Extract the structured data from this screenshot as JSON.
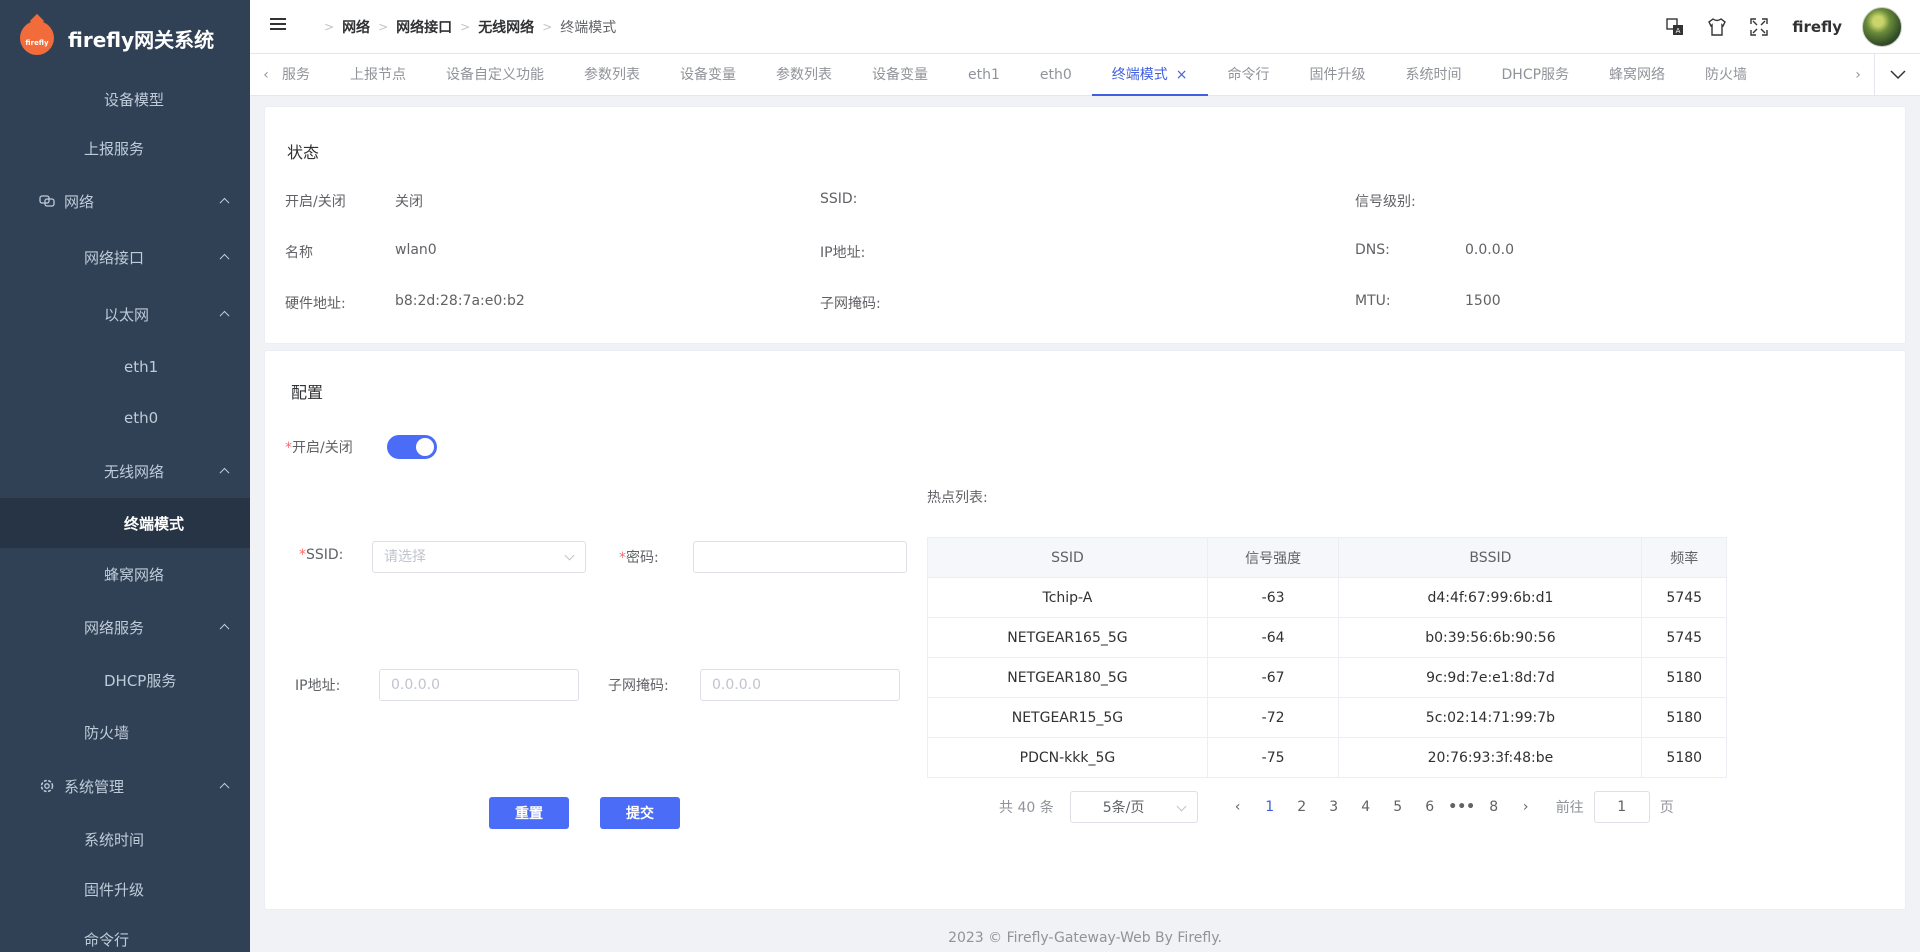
{
  "app": {
    "title": "firefly网关系统",
    "logo_text": "firefly"
  },
  "sidebar": {
    "items": [
      {
        "label": "设备模型"
      },
      {
        "label": "上报服务"
      },
      {
        "label": "网络"
      },
      {
        "label": "网络接口"
      },
      {
        "label": "以太网"
      },
      {
        "label": "eth1"
      },
      {
        "label": "eth0"
      },
      {
        "label": "无线网络"
      },
      {
        "label": "终端模式"
      },
      {
        "label": "蜂窝网络"
      },
      {
        "label": "网络服务"
      },
      {
        "label": "DHCP服务"
      },
      {
        "label": "防火墙"
      },
      {
        "label": "系统管理"
      },
      {
        "label": "系统时间"
      },
      {
        "label": "固件升级"
      },
      {
        "label": "命令行"
      }
    ]
  },
  "header": {
    "breadcrumbs": [
      "网络",
      "网络接口",
      "无线网络",
      "终端模式"
    ],
    "username": "firefly"
  },
  "tabs": {
    "items": [
      "服务",
      "上报节点",
      "设备自定义功能",
      "参数列表",
      "设备变量",
      "参数列表",
      "设备变量",
      "eth1",
      "eth0",
      "终端模式",
      "命令行",
      "固件升级",
      "系统时间",
      "DHCP服务",
      "蜂窝网络",
      "防火墙"
    ],
    "close_icon": "×"
  },
  "status": {
    "title": "状态",
    "enable_label": "开启/关闭",
    "enable_value": "关闭",
    "ssid_label": "SSID:",
    "ssid_value": "",
    "signal_label": "信号级别:",
    "signal_value": "",
    "name_label": "名称",
    "name_value": "wlan0",
    "ip_label": "IP地址:",
    "ip_value": "",
    "dns_label": "DNS:",
    "dns_value": "0.0.0.0",
    "mac_label": "硬件地址:",
    "mac_value": "b8:2d:28:7a:e0:b2",
    "mask_label": "子网掩码:",
    "mask_value": "",
    "mtu_label": "MTU:",
    "mtu_value": "1500"
  },
  "config": {
    "title": "配置",
    "enable_label": "开启/关闭",
    "enable_on": true,
    "ssid_label": "SSID:",
    "ssid_placeholder": "请选择",
    "password_label": "密码:",
    "ip_label": "IP地址:",
    "ip_placeholder": "0.0.0.0",
    "mask_label": "子网掩码:",
    "mask_placeholder": "0.0.0.0",
    "reset_label": "重置",
    "submit_label": "提交",
    "required_mark": "*"
  },
  "hotspots": {
    "title": "热点列表:",
    "columns": [
      "SSID",
      "信号强度",
      "BSSID",
      "频率"
    ],
    "rows": [
      [
        "Tchip-A",
        "-63",
        "d4:4f:67:99:6b:d1",
        "5745"
      ],
      [
        "NETGEAR165_5G",
        "-64",
        "b0:39:56:6b:90:56",
        "5745"
      ],
      [
        "NETGEAR180_5G",
        "-67",
        "9c:9d:7e:e1:8d:7d",
        "5180"
      ],
      [
        "NETGEAR15_5G",
        "-72",
        "5c:02:14:71:99:7b",
        "5180"
      ],
      [
        "PDCN-kkk_5G",
        "-75",
        "20:76:93:3f:48:be",
        "5180"
      ]
    ]
  },
  "pagination": {
    "total": "共 40 条",
    "page_size": "5条/页",
    "pages": [
      "1",
      "2",
      "3",
      "4",
      "5",
      "6",
      "•••",
      "8"
    ],
    "current": "1",
    "goto_label": "前往",
    "goto_value": "1",
    "page_unit": "页"
  },
  "footer": {
    "text": "2023 © Firefly-Gateway-Web By Firefly."
  }
}
